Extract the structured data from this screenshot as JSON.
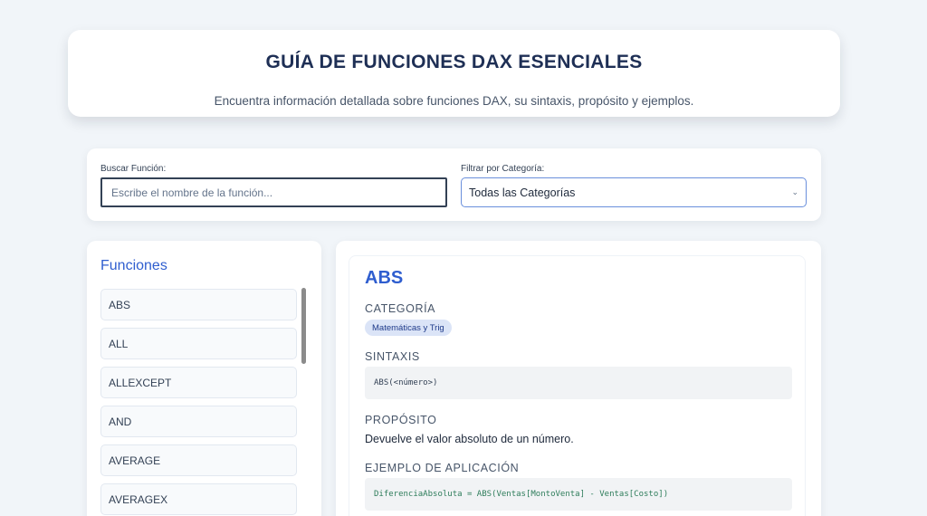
{
  "header": {
    "title": "GUÍA DE FUNCIONES DAX ESENCIALES",
    "subtitle": "Encuentra información detallada sobre funciones DAX, su sintaxis, propósito y ejemplos."
  },
  "filters": {
    "search_label": "Buscar Función:",
    "search_placeholder": "Escribe el nombre de la función...",
    "search_value": "",
    "category_label": "Filtrar por Categoría:",
    "category_selected": "Todas las Categorías",
    "chevron_icon": "chevron-down-icon"
  },
  "sidebar": {
    "title": "Funciones",
    "items": [
      "ABS",
      "ALL",
      "ALLEXCEPT",
      "AND",
      "AVERAGE",
      "AVERAGEX"
    ]
  },
  "detail": {
    "name": "ABS",
    "category_label": "CATEGORÍA",
    "category": "Matemáticas y Trig",
    "syntax_label": "SINTAXIS",
    "syntax": "ABS(<número>)",
    "purpose_label": "PROPÓSITO",
    "purpose": "Devuelve el valor absoluto de un número.",
    "example_label": "EJEMPLO DE APLICACIÓN",
    "example": "DiferenciaAbsoluta = ABS(Ventas[MontoVenta] - Ventas[Costo])"
  },
  "colors": {
    "accent": "#2f5ecf",
    "header_title": "#1e2f55",
    "background": "#f1f5f9",
    "badge_bg": "#dbe4f7",
    "code_example": "#2e7d5b"
  }
}
